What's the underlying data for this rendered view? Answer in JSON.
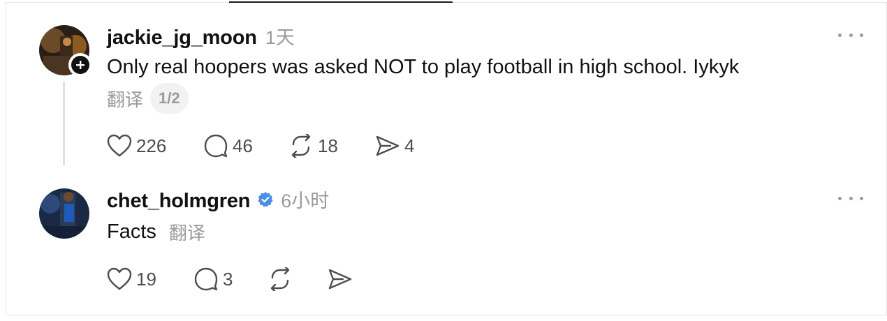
{
  "posts": [
    {
      "username": "jackie_jg_moon",
      "time": "1天",
      "text": "Only real hoopers was asked NOT to play football in high school. Iykyk",
      "translate_label": "翻译",
      "pager": "1/2",
      "likes": "226",
      "replies": "46",
      "reposts": "18",
      "shares": "4",
      "avatar_icon": "user-avatar",
      "follow_icon": "plus-icon"
    },
    {
      "username": "chet_holmgren",
      "verified_icon": "verified-badge-icon",
      "time": "6小时",
      "text": "Facts",
      "translate_label": "翻译",
      "likes": "19",
      "replies": "3",
      "reposts": "",
      "shares": "",
      "avatar_icon": "user-avatar"
    }
  ],
  "colors": {
    "verified": "#4a90e2",
    "muted": "#9a9a9a",
    "text": "#111111"
  }
}
